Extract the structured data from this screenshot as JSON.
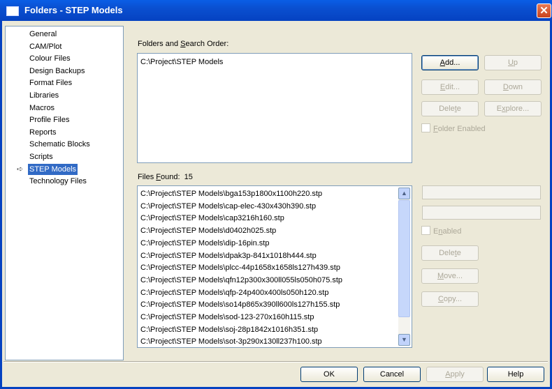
{
  "window": {
    "title": "Folders - STEP Models",
    "close_glyph": "✕"
  },
  "tree": {
    "items": [
      "General",
      "CAM/Plot",
      "Colour Files",
      "Design Backups",
      "Format Files",
      "Libraries",
      "Macros",
      "Profile Files",
      "Reports",
      "Schematic Blocks",
      "Scripts",
      "STEP Models",
      "Technology Files"
    ],
    "selected": "STEP Models",
    "selected_indicator": "➪"
  },
  "folders": {
    "label_pre": "Folders and ",
    "label_u": "S",
    "label_post": "earch Order:",
    "entries": [
      "C:\\Project\\STEP Models"
    ]
  },
  "buttons": {
    "add": "Add...",
    "up": "Up",
    "edit": "Edit...",
    "down": "Down",
    "delete": "Delete",
    "explore": "Explore...",
    "file_delete": "Delete",
    "move": "Move...",
    "copy": "Copy...",
    "ok": "OK",
    "cancel": "Cancel",
    "apply": "Apply",
    "help": "Help"
  },
  "checkboxes": {
    "folder_enabled": "Folder Enabled",
    "enabled": "Enabled"
  },
  "files": {
    "label_pre": "Files ",
    "label_u": "F",
    "label_post": "ound:",
    "count": "15",
    "entries": [
      "C:\\Project\\STEP Models\\bga153p1800x1100h220.stp",
      "C:\\Project\\STEP Models\\cap-elec-430x430h390.stp",
      "C:\\Project\\STEP Models\\cap3216h160.stp",
      "C:\\Project\\STEP Models\\d0402h025.stp",
      "C:\\Project\\STEP Models\\dip-16pin.stp",
      "C:\\Project\\STEP Models\\dpak3p-841x1018h444.stp",
      "C:\\Project\\STEP Models\\plcc-44p1658x1658ls127h439.stp",
      "C:\\Project\\STEP Models\\qfn12p300x300ll055ls050h075.stp",
      "C:\\Project\\STEP Models\\qfp-24p400x400ls050h120.stp",
      "C:\\Project\\STEP Models\\so14p865x390ll600ls127h155.stp",
      "C:\\Project\\STEP Models\\sod-123-270x160h115.stp",
      "C:\\Project\\STEP Models\\soj-28p1842x1016h351.stp",
      "C:\\Project\\STEP Models\\sot-3p290x130ll237h100.stp"
    ]
  },
  "scroll_icons": {
    "up": "▲",
    "down": "▼"
  },
  "colors": {
    "title_bar": "#0542c1",
    "selection": "#316ac5",
    "face": "#ece9d8"
  }
}
